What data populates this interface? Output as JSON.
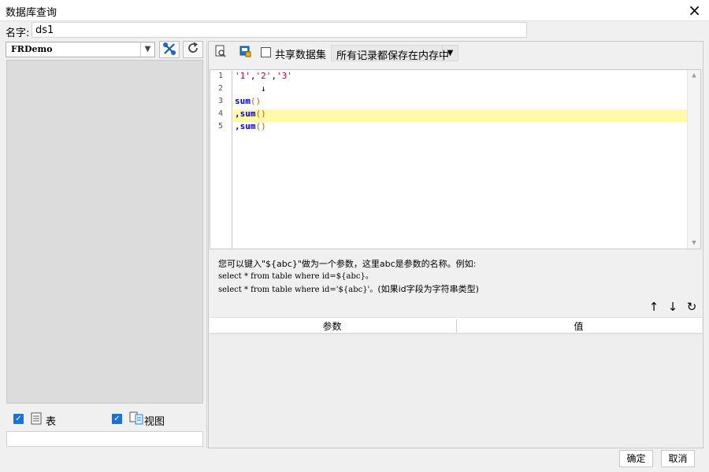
{
  "window": {
    "title": "数据库查询",
    "close_icon": "×"
  },
  "name_field": {
    "label": "名字:",
    "value": "ds1"
  },
  "left_panel": {
    "database": "FRDemo",
    "filters": [
      {
        "label": "表",
        "checked": true
      },
      {
        "label": "视图",
        "checked": true
      }
    ]
  },
  "toolbar": {
    "share_label": "共享数据集",
    "share_checked": false,
    "save_mode": "所有记录都保存在内存中"
  },
  "editor": {
    "line_numbers": [
      "1",
      "2",
      "3",
      "4",
      "5"
    ],
    "arrow": "↓",
    "highlight_line": 4,
    "string_1": "'1'",
    "string_2": "'2'",
    "string_3": "'3'",
    "sep": ",",
    "fn": "sum",
    "parens": "()"
  },
  "hint": {
    "line1": "您可以键入\"${abc}\"做为一个参数，这里abc是参数的名称。例如:",
    "line2": "select * from table where id=${abc}。",
    "line3a": "select * from table where id='${abc}'。",
    "line3b": "(如果id字段为字符串类型)"
  },
  "params_table": {
    "columns": [
      "参数",
      "值"
    ]
  },
  "footer": {
    "ok_label": "确定",
    "cancel_label": "取消"
  },
  "colors": {
    "accent": "#1f72d0",
    "highlight": "#fffaa8",
    "string": "#c0003a",
    "keyword": "#0000d0"
  }
}
